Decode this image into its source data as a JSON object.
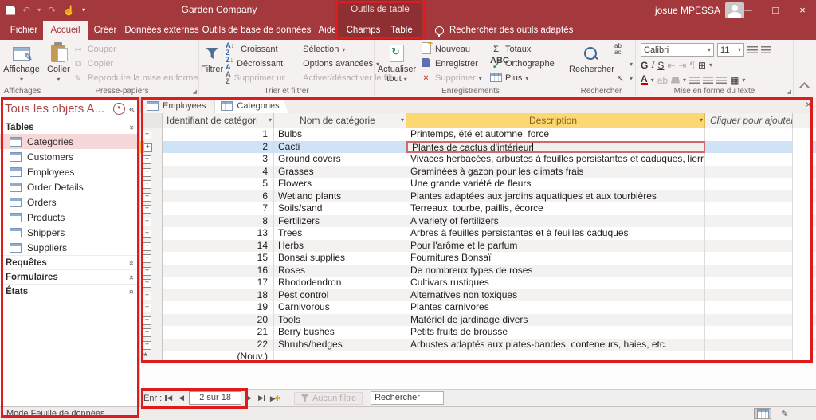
{
  "colors": {
    "brand_red": "#a4393d",
    "contextual_red": "#8e2f33",
    "annotation_red": "#df1c1c",
    "selection_blue": "#cee3f5",
    "header_gold": "#fbd871",
    "nav_selected_pink": "#f7d8d8",
    "edit_indicator_gold": "#f2c231"
  },
  "icons": {
    "undo": "↶",
    "redo": "↷",
    "touch": "☝",
    "dropdown": "▾",
    "minimize": "─",
    "maximize": "□",
    "close": "×",
    "collapse_pane": "«",
    "chevrons": "»",
    "sum": "Σ",
    "check": "✓",
    "refresh": "↻",
    "cut": "✂",
    "pencil": "✎",
    "paragraph": "¶",
    "gridlines": "⊞",
    "alt_rows": "▦",
    "goto": "→",
    "select_cursor": "↖",
    "indent_left": "⇤",
    "indent_right": "⇥",
    "new_record_star": "∗",
    "launcher": "◢",
    "first": "◀",
    "prev": "◀",
    "next": "▶",
    "last": "▶"
  },
  "titlebar": {
    "app_title": "Garden Company",
    "contextual_label": "Outils de table",
    "user_name": "josue MPESSA"
  },
  "ribbon_tabs": {
    "file": "Fichier",
    "home": "Accueil",
    "create": "Créer",
    "external": "Données externes",
    "dbtools": "Outils de base de données",
    "help": "Aide",
    "fields": "Champs",
    "table": "Table"
  },
  "tell_me": "Rechercher des outils adaptés",
  "ribbon": {
    "views": {
      "main": "Affichage",
      "group": "Affichages"
    },
    "clipboard": {
      "main": "Coller",
      "cut": "Couper",
      "copy": "Copier",
      "painter": "Reproduire la mise en forme",
      "group": "Presse-papiers"
    },
    "sort": {
      "main": "Filtrer",
      "asc": "Croissant",
      "desc": "Décroissant",
      "clear": "Supprimer un tri",
      "selection": "Sélection",
      "advanced": "Options avancées",
      "toggle": "Activer/désactiver le filtre",
      "group": "Trier et filtrer"
    },
    "records": {
      "main": "Actualiser tout",
      "new": "Nouveau",
      "save": "Enregistrer",
      "delete": "Supprimer",
      "totals": "Totaux",
      "spelling": "Orthographe",
      "more": "Plus",
      "group": "Enregistrements"
    },
    "find": {
      "main": "Rechercher",
      "group": "Rechercher"
    },
    "format": {
      "font": "Calibri",
      "size": "11",
      "bold": "G",
      "italic": "I",
      "underline": "S",
      "group": "Mise en forme du texte"
    }
  },
  "nav_pane": {
    "title": "Tous les objets A...",
    "sections": {
      "tables": "Tables",
      "queries": "Requêtes",
      "forms": "Formulaires",
      "reports": "États"
    },
    "tables": [
      "Categories",
      "Customers",
      "Employees",
      "Order Details",
      "Orders",
      "Products",
      "Shippers",
      "Suppliers"
    ],
    "selected_index": 0
  },
  "doc_tabs": [
    "Employees",
    "Categories"
  ],
  "table": {
    "headers": {
      "id": "Identifiant de catégori",
      "name": "Nom de catégorie",
      "desc": "Description",
      "add": "Cliquer pour ajouter"
    },
    "rows": [
      {
        "id": "1",
        "name": "Bulbs",
        "desc": "Printemps, été et automne, forcé"
      },
      {
        "id": "2",
        "name": "Cacti",
        "desc": "Plantes de cactus d'intérieur",
        "state": "selected"
      },
      {
        "id": "3",
        "name": "Ground covers",
        "desc": "Vivaces herbacées, arbustes à feuilles persistantes et caduques, lierre, vignes, mousses"
      },
      {
        "id": "4",
        "name": "Grasses",
        "desc": "Graminées à gazon pour les climats frais"
      },
      {
        "id": "5",
        "name": "Flowers",
        "desc": "Une grande variété de fleurs"
      },
      {
        "id": "6",
        "name": "Wetland plants",
        "desc": "Plantes adaptées aux jardins aquatiques et aux tourbières"
      },
      {
        "id": "7",
        "name": "Soils/sand",
        "desc": "Terreaux, tourbe, paillis, écorce"
      },
      {
        "id": "8",
        "name": "Fertilizers",
        "desc": "A variety of fertilizers"
      },
      {
        "id": "13",
        "name": "Trees",
        "desc": "Arbres à feuilles persistantes et à feuilles caduques"
      },
      {
        "id": "14",
        "name": "Herbs",
        "desc": "Pour l'arôme et le parfum"
      },
      {
        "id": "15",
        "name": "Bonsai supplies",
        "desc": "Fournitures Bonsaï"
      },
      {
        "id": "16",
        "name": "Roses",
        "desc": "De nombreux types de roses"
      },
      {
        "id": "17",
        "name": "Rhododendron",
        "desc": "Cultivars rustiques"
      },
      {
        "id": "18",
        "name": "Pest control",
        "desc": "Alternatives non toxiques"
      },
      {
        "id": "19",
        "name": "Carnivorous",
        "desc": "Plantes carnivores"
      },
      {
        "id": "20",
        "name": "Tools",
        "desc": "Matériel de jardinage divers"
      },
      {
        "id": "21",
        "name": "Berry bushes",
        "desc": "Petits fruits de brousse"
      },
      {
        "id": "22",
        "name": "Shrubs/hedges",
        "desc": "Arbustes adaptés aux plates-bandes, conteneurs, haies, etc."
      },
      {
        "id": "(Nouv.)",
        "name": "",
        "desc": "",
        "state": "new"
      }
    ]
  },
  "record_nav": {
    "label": "Enr :",
    "position": "2 sur 18",
    "no_filter": "Aucun filtre",
    "search": "Rechercher"
  },
  "status": {
    "left": "Mode Feuille de données"
  }
}
